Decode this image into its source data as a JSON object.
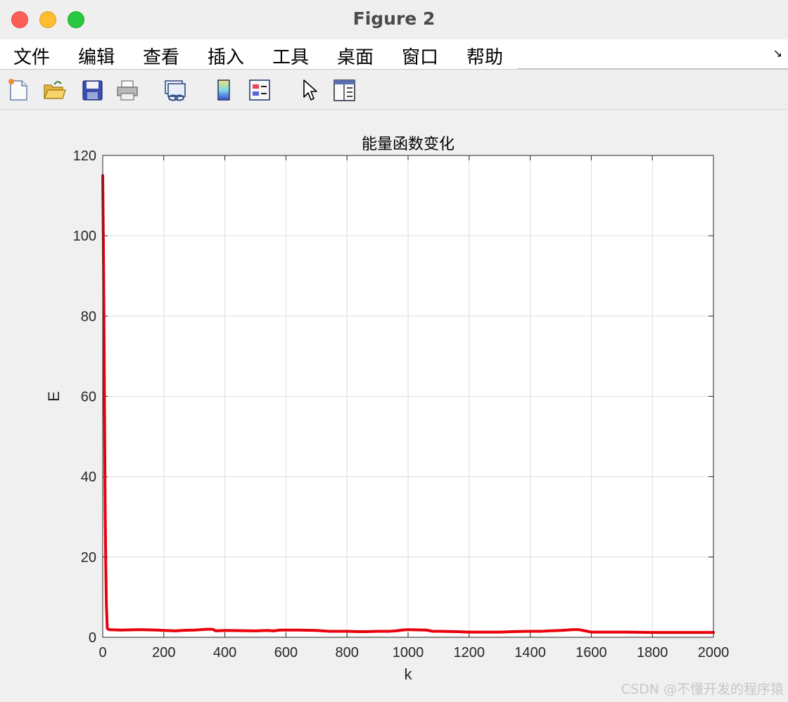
{
  "window": {
    "title": "Figure 2"
  },
  "menu": {
    "items": [
      "文件",
      "编辑",
      "查看",
      "插入",
      "工具",
      "桌面",
      "窗口",
      "帮助"
    ],
    "overflow_icon": "dock-arrow-icon"
  },
  "toolbar": {
    "tools": [
      "new-figure-icon",
      "open-file-icon",
      "save-icon",
      "print-icon",
      "link-plot-icon",
      "colorbar-icon",
      "legend-icon",
      "pointer-icon",
      "property-editor-icon"
    ]
  },
  "chart_data": {
    "type": "line",
    "title": "能量函数变化",
    "xlabel": "k",
    "ylabel": "E",
    "xlim": [
      0,
      2000
    ],
    "ylim": [
      0,
      120
    ],
    "xticks": [
      0,
      200,
      400,
      600,
      800,
      1000,
      1200,
      1400,
      1600,
      1800,
      2000
    ],
    "yticks": [
      0,
      20,
      40,
      60,
      80,
      100,
      120
    ],
    "grid": true,
    "series": [
      {
        "color": "#e8000b",
        "x": [
          0,
          2,
          4,
          6,
          8,
          10,
          12,
          15,
          20,
          60,
          120,
          180,
          200,
          240,
          260,
          300,
          340,
          360,
          370,
          400,
          500,
          540,
          560,
          580,
          640,
          700,
          720,
          740,
          800,
          840,
          860,
          900,
          940,
          960,
          980,
          1000,
          1060,
          1080,
          1100,
          1160,
          1200,
          1300,
          1340,
          1400,
          1440,
          1460,
          1500,
          1540,
          1560,
          1580,
          1600,
          1700,
          1800,
          1900,
          2000
        ],
        "y": [
          115,
          100,
          80,
          55,
          32,
          18,
          8,
          2.2,
          1.9,
          1.8,
          1.9,
          1.8,
          1.7,
          1.6,
          1.7,
          1.8,
          2.0,
          2.0,
          1.6,
          1.7,
          1.6,
          1.7,
          1.6,
          1.8,
          1.8,
          1.7,
          1.6,
          1.5,
          1.5,
          1.4,
          1.4,
          1.5,
          1.5,
          1.6,
          1.8,
          1.9,
          1.8,
          1.5,
          1.5,
          1.4,
          1.3,
          1.3,
          1.4,
          1.5,
          1.5,
          1.6,
          1.7,
          1.9,
          1.9,
          1.6,
          1.3,
          1.3,
          1.2,
          1.2,
          1.2
        ]
      }
    ]
  },
  "watermark": "CSDN @不懂开发的程序猿"
}
